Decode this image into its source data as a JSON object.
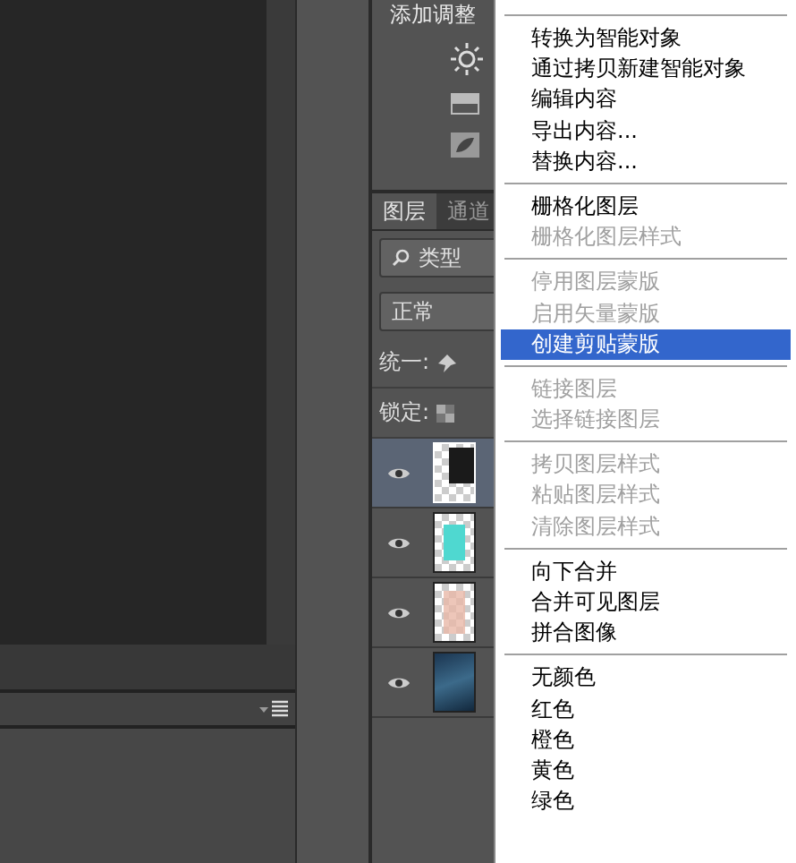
{
  "panel": {
    "title": "添加调整",
    "tabs": [
      {
        "label": "图层",
        "selected": true
      },
      {
        "label": "通道",
        "selected": false
      }
    ],
    "filter": "类型",
    "blend_mode": "正常",
    "unify_label": "统一:",
    "lock_label": "锁定:",
    "layers": [
      {
        "kind": "smart-dark",
        "selected": true,
        "visible": true
      },
      {
        "kind": "cyan",
        "selected": false,
        "visible": true
      },
      {
        "kind": "pink",
        "selected": false,
        "visible": true
      },
      {
        "kind": "photo",
        "selected": false,
        "visible": true
      }
    ]
  },
  "menu": [
    {
      "kind": "separator"
    },
    {
      "kind": "item",
      "label": "转换为智能对象",
      "disabled": false,
      "selected": false
    },
    {
      "kind": "item",
      "label": "通过拷贝新建智能对象",
      "disabled": false,
      "selected": false
    },
    {
      "kind": "item",
      "label": "编辑内容",
      "disabled": false,
      "selected": false
    },
    {
      "kind": "item",
      "label": "导出内容...",
      "disabled": false,
      "selected": false
    },
    {
      "kind": "item",
      "label": "替换内容...",
      "disabled": false,
      "selected": false
    },
    {
      "kind": "separator"
    },
    {
      "kind": "item",
      "label": "栅格化图层",
      "disabled": false,
      "selected": false
    },
    {
      "kind": "item",
      "label": "栅格化图层样式",
      "disabled": true,
      "selected": false
    },
    {
      "kind": "separator"
    },
    {
      "kind": "item",
      "label": "停用图层蒙版",
      "disabled": true,
      "selected": false
    },
    {
      "kind": "item",
      "label": "启用矢量蒙版",
      "disabled": true,
      "selected": false
    },
    {
      "kind": "item",
      "label": "创建剪贴蒙版",
      "disabled": false,
      "selected": true
    },
    {
      "kind": "separator"
    },
    {
      "kind": "item",
      "label": "链接图层",
      "disabled": true,
      "selected": false
    },
    {
      "kind": "item",
      "label": "选择链接图层",
      "disabled": true,
      "selected": false
    },
    {
      "kind": "separator"
    },
    {
      "kind": "item",
      "label": "拷贝图层样式",
      "disabled": true,
      "selected": false
    },
    {
      "kind": "item",
      "label": "粘贴图层样式",
      "disabled": true,
      "selected": false
    },
    {
      "kind": "item",
      "label": "清除图层样式",
      "disabled": true,
      "selected": false
    },
    {
      "kind": "separator"
    },
    {
      "kind": "item",
      "label": "向下合并",
      "disabled": false,
      "selected": false
    },
    {
      "kind": "item",
      "label": "合并可见图层",
      "disabled": false,
      "selected": false
    },
    {
      "kind": "item",
      "label": "拼合图像",
      "disabled": false,
      "selected": false
    },
    {
      "kind": "separator"
    },
    {
      "kind": "item",
      "label": "无颜色",
      "disabled": false,
      "selected": false
    },
    {
      "kind": "item",
      "label": "红色",
      "disabled": false,
      "selected": false
    },
    {
      "kind": "item",
      "label": "橙色",
      "disabled": false,
      "selected": false
    },
    {
      "kind": "item",
      "label": "黄色",
      "disabled": false,
      "selected": false
    },
    {
      "kind": "item",
      "label": "绿色",
      "disabled": false,
      "selected": false
    }
  ]
}
